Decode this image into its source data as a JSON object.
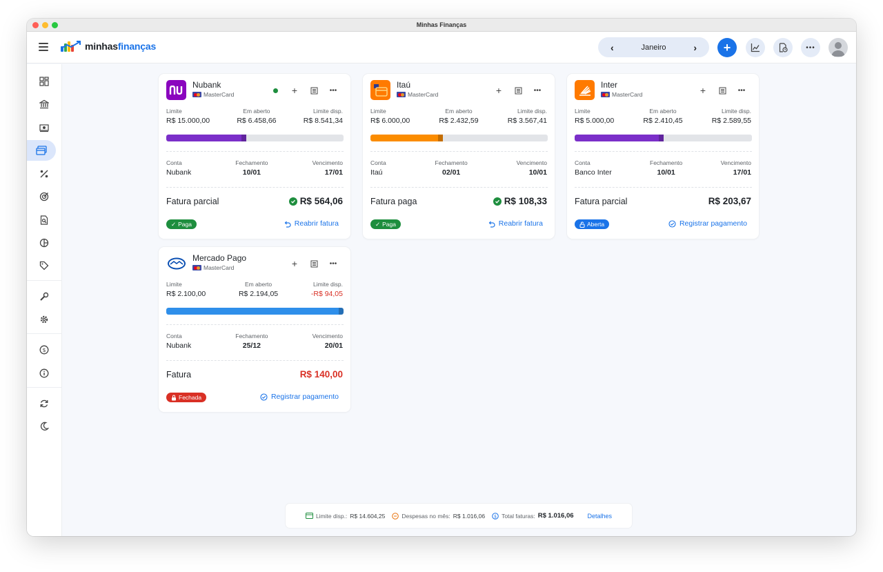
{
  "window": {
    "title": "Minhas Finanças"
  },
  "brand": {
    "part1": "minhas",
    "part2": "finanças"
  },
  "month_nav": {
    "label": "Janeiro",
    "prev": "‹",
    "next": "›"
  },
  "toolbar": {
    "add": "+",
    "more": "•••"
  },
  "colors": {
    "accent": "#1a73e8",
    "nubank": "#8a05be",
    "itau": "#ff7a00",
    "inter": "#ff7a00",
    "mercado_bar": "#2f8fea",
    "success": "#1e8e3e",
    "danger": "#d93025"
  },
  "labels": {
    "limite": "Limite",
    "em_aberto": "Em aberto",
    "limite_disp": "Limite disp.",
    "conta": "Conta",
    "fechamento": "Fechamento",
    "vencimento": "Vencimento"
  },
  "cards": [
    {
      "name": "Nubank",
      "brand": "MasterCard",
      "limite": "R$ 15.000,00",
      "em_aberto": "R$ 6.458,66",
      "limite_disp": "R$ 8.541,34",
      "usage": 0.45,
      "bar_color": "#7b2fc9",
      "conta": "Nubank",
      "fechamento": "10/01",
      "vencimento": "17/01",
      "fatura_label": "Fatura parcial",
      "fatura_value": "R$ 564,06",
      "status": "Paga",
      "action": "Reabrir fatura"
    },
    {
      "name": "Itaú",
      "brand": "MasterCard",
      "limite": "R$ 6.000,00",
      "em_aberto": "R$ 2.432,59",
      "limite_disp": "R$ 3.567,41",
      "usage": 0.41,
      "bar_color": "#fb8c00",
      "conta": "Itaú",
      "fechamento": "02/01",
      "vencimento": "10/01",
      "fatura_label": "Fatura paga",
      "fatura_value": "R$ 108,33",
      "status": "Paga",
      "action": "Reabrir fatura"
    },
    {
      "name": "Inter",
      "brand": "MasterCard",
      "limite": "R$ 5.000,00",
      "em_aberto": "R$ 2.410,45",
      "limite_disp": "R$ 2.589,55",
      "usage": 0.5,
      "bar_color": "#7b2fc9",
      "conta": "Banco Inter",
      "fechamento": "10/01",
      "vencimento": "17/01",
      "fatura_label": "Fatura parcial",
      "fatura_value": "R$ 203,67",
      "status": "Aberta",
      "action": "Registrar pagamento"
    },
    {
      "name": "Mercado Pago",
      "brand": "MasterCard",
      "limite": "R$ 2.100,00",
      "em_aberto": "R$ 2.194,05",
      "limite_disp": "-R$ 94,05",
      "usage": 1.0,
      "bar_color": "#2f8fea",
      "conta": "Nubank",
      "fechamento": "25/12",
      "vencimento": "20/01",
      "fatura_label": "Fatura",
      "fatura_value": "R$ 140,00",
      "status": "Fechada",
      "action": "Registrar pagamento"
    }
  ],
  "footer": {
    "limite_label": "Limite disp.:",
    "limite_value": "R$ 14.604,25",
    "despesas_label": "Despesas no mês:",
    "despesas_value": "R$ 1.016,06",
    "total_label": "Total faturas:",
    "total_value": "R$ 1.016,06",
    "detalhes": "Detalhes"
  }
}
